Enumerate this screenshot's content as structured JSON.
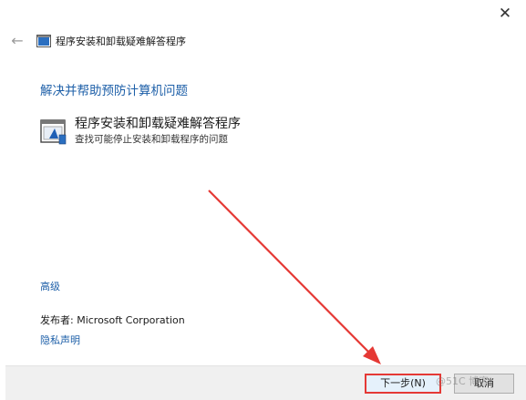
{
  "window": {
    "title": "程序安装和卸载疑难解答程序",
    "close_glyph": "✕",
    "back_glyph": "←"
  },
  "main": {
    "heading": "解决并帮助预防计算机问题",
    "item": {
      "title": "程序安装和卸载疑难解答程序",
      "description": "查找可能停止安装和卸载程序的问题"
    },
    "advanced_link": "高级",
    "publisher_label": "发布者: ",
    "publisher_name": "Microsoft Corporation",
    "privacy_link": "隐私声明"
  },
  "footer": {
    "next_label": "下一步(N)",
    "cancel_label": "取消"
  },
  "watermark": "@51C 博客",
  "colors": {
    "link": "#1d5fa8",
    "annotation_red": "#e53935",
    "footer_bg": "#f0f0f0"
  },
  "icons": {
    "title_icon": "troubleshooter-icon",
    "item_icon": "program-troubleshooter-icon"
  }
}
